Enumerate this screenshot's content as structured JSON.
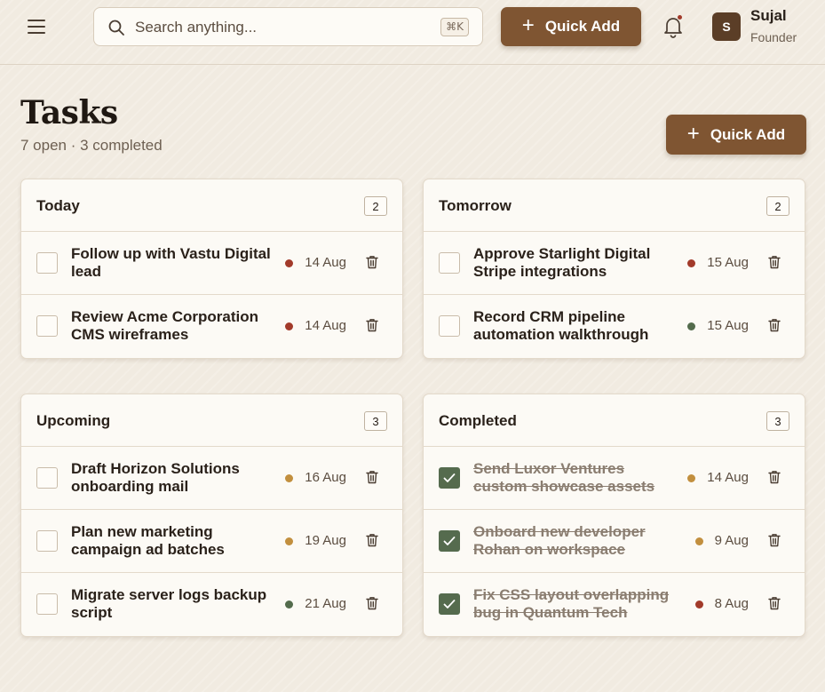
{
  "topbar": {
    "search_placeholder": "Search anything...",
    "shortcut": "⌘K",
    "quick_add_label": "Quick Add",
    "user_initial": "S",
    "user_name": "Sujal",
    "user_role": "Founder"
  },
  "page": {
    "title": "Tasks",
    "subtitle": "7 open · 3 completed",
    "quick_add_label": "Quick Add"
  },
  "colors": {
    "accent": "#7f5532",
    "priority_high": "#a23a2a",
    "priority_medium": "#c28f3e",
    "priority_low": "#536b4c"
  },
  "icons": [
    "menu-icon",
    "search-icon",
    "plus-icon",
    "bell-icon",
    "checkbox-icon",
    "check-icon",
    "trash-icon"
  ],
  "columns": [
    {
      "title": "Today",
      "count": "2",
      "tasks": [
        {
          "text": "Follow up with Vastu Digital lead",
          "date": "14 Aug",
          "priority": "high",
          "done": false
        },
        {
          "text": "Review Acme Corporation CMS wireframes",
          "date": "14 Aug",
          "priority": "high",
          "done": false
        }
      ]
    },
    {
      "title": "Tomorrow",
      "count": "2",
      "tasks": [
        {
          "text": "Approve Starlight Digital Stripe integrations",
          "date": "15 Aug",
          "priority": "high",
          "done": false
        },
        {
          "text": "Record CRM pipeline automation walkthrough",
          "date": "15 Aug",
          "priority": "low",
          "done": false
        }
      ]
    },
    {
      "title": "Upcoming",
      "count": "3",
      "tasks": [
        {
          "text": "Draft Horizon Solutions onboarding mail",
          "date": "16 Aug",
          "priority": "medium",
          "done": false
        },
        {
          "text": "Plan new marketing campaign ad batches",
          "date": "19 Aug",
          "priority": "medium",
          "done": false
        },
        {
          "text": "Migrate server logs backup script",
          "date": "21 Aug",
          "priority": "low",
          "done": false
        }
      ]
    },
    {
      "title": "Completed",
      "count": "3",
      "tasks": [
        {
          "text": "Send Luxor Ventures custom showcase assets",
          "date": "14 Aug",
          "priority": "medium",
          "done": true
        },
        {
          "text": "Onboard new developer Rohan on workspace",
          "date": "9 Aug",
          "priority": "medium",
          "done": true
        },
        {
          "text": "Fix CSS layout overlapping bug in Quantum Tech",
          "date": "8 Aug",
          "priority": "high",
          "done": true
        }
      ]
    }
  ]
}
